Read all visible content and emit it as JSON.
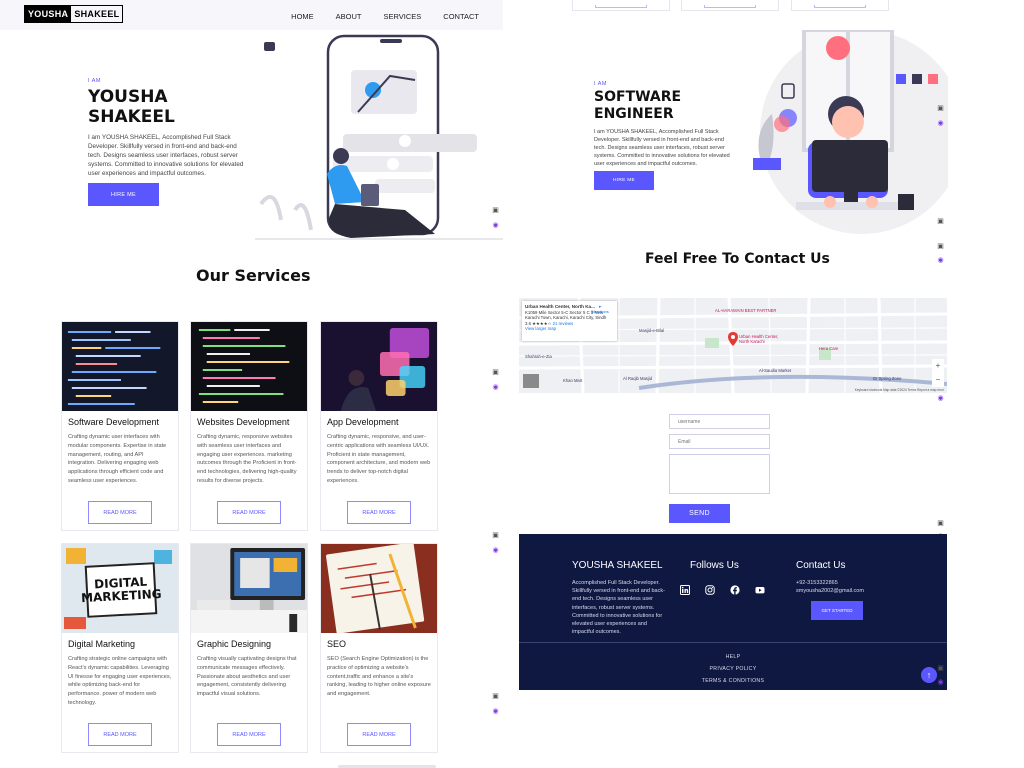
{
  "nav": {
    "logo_left": "YOUSHA",
    "logo_right": "SHAKEEL",
    "links": [
      "HOME",
      "ABOUT",
      "SERVICES",
      "CONTACT"
    ]
  },
  "hero_left": {
    "eyebrow": "I AM",
    "name_line1": "YOUSHA",
    "name_line2": "SHAKEEL",
    "description": "I am YOUSHA SHAKEEL, Accomplished Full Stack Developer. Skillfully versed in front-end and back-end tech. Designs seamless user interfaces, robust server systems. Committed to innovative solutions for elevated user experiences and impactful outcomes.",
    "button": "HIRE ME"
  },
  "hero_right": {
    "eyebrow": "I AM",
    "name_line1": "SOFTWARE",
    "name_line2": "ENGINEER",
    "description": "I am YOUSHA SHAKEEL, Accomplished Full Stack Developer. Skillfully versed in front-end and back-end tech. Designs seamless user interfaces, robust server systems. Committed to innovative solutions for elevated user experiences and impactful outcomes.",
    "button": "HIRE ME"
  },
  "services": {
    "title": "Our Services",
    "read_more": "READ MORE",
    "items": [
      {
        "title": "Software Development",
        "description": "Crafting dynamic user interfaces with modular components. Expertise in state management, routing, and API integration. Delivering engaging web applications through efficient code and seamless user experiences."
      },
      {
        "title": "Websites Development",
        "description": "Crafting dynamic, responsive websites with seamless user interfaces and engaging user experiences. marketing outcomes through the Proficient in front-end technologies, delivering high-quality results for diverse projects."
      },
      {
        "title": "App Development",
        "description": "Crafting dynamic, responsive, and user-centric applications with seamless UI/UX. Proficient in state management, component architecture, and modern web trends to deliver top-notch digital experiences."
      },
      {
        "title": "Digital Marketing",
        "description": "Crafting strategic online campaigns with React's dynamic capabilities. Leveraging UI finesse for engaging user experiences, while optimizing back-end for performance. power of modern web technology."
      },
      {
        "title": "Graphic Designing",
        "description": "Crafting visually captivating designs that communicate messages effectively. Passionate about aesthetics and user engagement, consistently delivering impactful visual solutions."
      },
      {
        "title": "SEO",
        "description": "SEO (Search Engine Optimization) is the practice of optimizing a website's content,traffic and enhance a site's ranking, leading to higher online exposure and engagement."
      }
    ],
    "digital_marketing_image_text": "DIGITAL MARKETING"
  },
  "contact": {
    "title": "Feel Free To Contact Us",
    "map": {
      "place": "Urban Health Center, North Ka...",
      "address": "K1059 Mile Sector 5-C Sector 5 C 3 New Karachi Town, Karachi, Karachi City, Sindh",
      "rating": "3.6",
      "reviews": "21 reviews",
      "view_larger": "View larger map",
      "directions": "Directions",
      "labels": [
        "Urban Health Center, North Karachi",
        "AL-HARAMAIN BEST PARTNER",
        "Masjid-e-Bilal",
        "Shahrah-e-Zia",
        "Hera Care",
        "Al Raqib Masjid",
        "Khan Mart",
        "Al-Saudia Market",
        "Dr Spring Zone"
      ],
      "footer": "Keyboard shortcuts  Map data ©2024  Terms  Report a map error"
    },
    "username_placeholder": "username",
    "email_placeholder": "Email",
    "send": "SEND"
  },
  "footer": {
    "brand": "YOUSHA SHAKEEL",
    "about": "Accomplished Full Stack Developer. Skillfully versed in front-end and back-end tech. Designs seamless user interfaces, robust server systems. Committed to innovative solutions for elevated user experiences and impactful outcomes.",
    "follow_title": "Follows Us",
    "contact_title": "Contact Us",
    "phone": "+92-3153322865",
    "email": "smyousha2002@gmail.com",
    "get_started": "GET STARTED",
    "links": [
      "HELP",
      "PRIVACY POLICY",
      "TERMS & CONDITIONS"
    ]
  },
  "colors": {
    "accent": "#5b57ff",
    "footer_bg": "#0f1840"
  }
}
